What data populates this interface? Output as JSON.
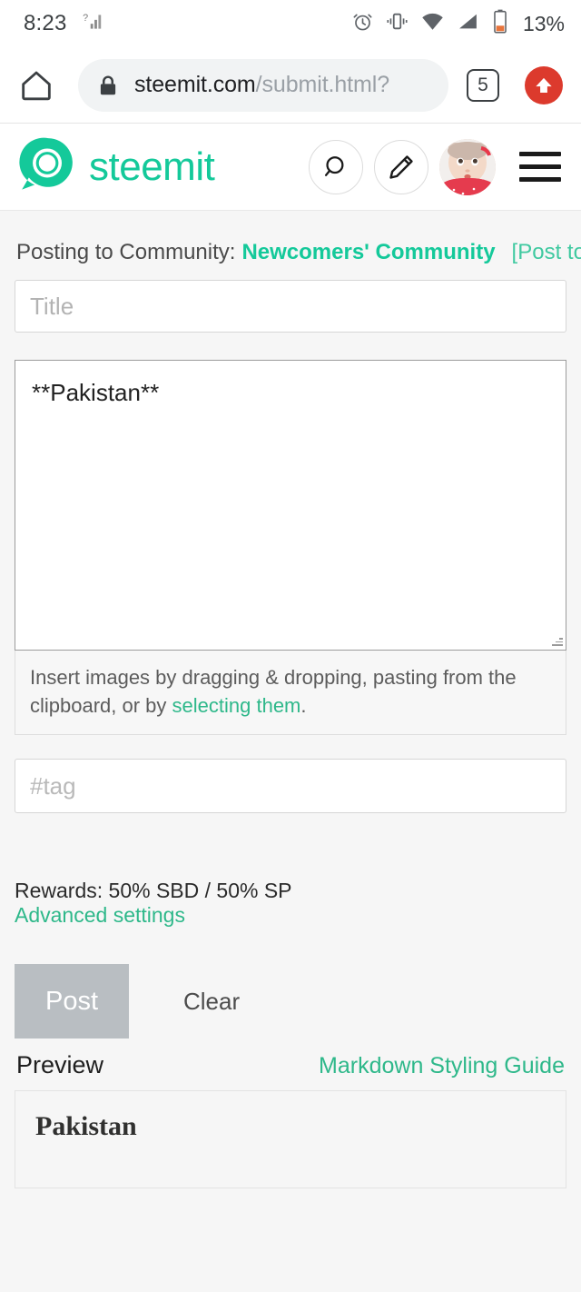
{
  "status_bar": {
    "time": "8:23",
    "battery_percent": "13%",
    "icons": [
      "signal-unknown-icon",
      "alarm-icon",
      "vibrate-icon",
      "wifi-icon",
      "cellular-icon",
      "battery-low-icon"
    ]
  },
  "browser": {
    "home_icon": "home-icon",
    "lock_icon": "lock-icon",
    "url_domain": "steemit.com",
    "url_path": "/submit.html?",
    "tab_count": "5",
    "upload_icon": "upload-arrow-icon"
  },
  "site_header": {
    "logo_icon": "steemit-logo-icon",
    "brand_name": "steemit",
    "search_icon": "search-icon",
    "pencil_icon": "pencil-icon",
    "avatar_alt": "user-avatar",
    "menu_icon": "hamburger-menu-icon"
  },
  "composer": {
    "posting_to_label": "Posting to Community:",
    "community_name": "Newcomers' Community",
    "post_to_blog_link": "[Post to blog]",
    "title_placeholder": "Title",
    "body_value": "**Pakistan**",
    "editor_help_prefix": "Insert images by dragging & dropping, pasting from the clipboard, or by ",
    "editor_help_link": "selecting them",
    "editor_help_suffix": ".",
    "tag_placeholder": "#tag",
    "rewards_text": "Rewards: 50% SBD / 50% SP",
    "advanced_settings_link": "Advanced settings",
    "post_button_label": "Post",
    "clear_button_label": "Clear",
    "preview_label": "Preview",
    "markdown_guide_link": "Markdown Styling Guide",
    "preview_content_heading": "Pakistan"
  },
  "colors": {
    "brand_green": "#14c99a",
    "link_green": "#2eb88a",
    "page_background": "#f6f6f6",
    "post_button_disabled": "#b9bec2",
    "upload_button_red": "#dc3a2d"
  }
}
